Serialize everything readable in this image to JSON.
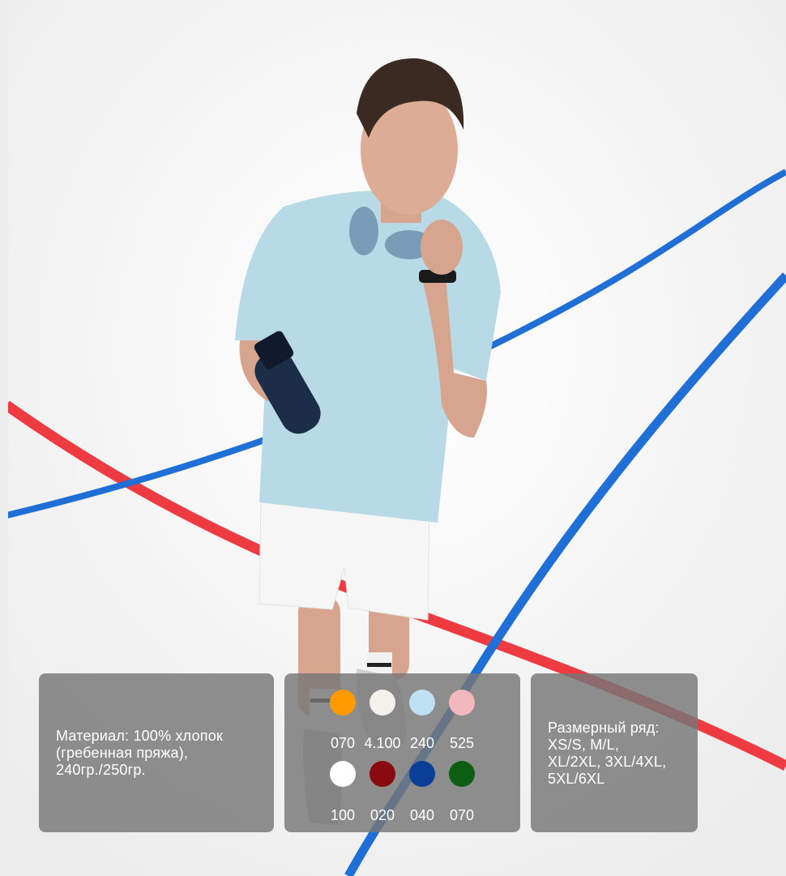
{
  "material": {
    "text": "Материал: 100% хлопок\n(гребенная пряжа),\n240гр./250гр."
  },
  "sizes": {
    "text": "Размерный ряд:\nXS/S, M/L,\nXL/2XL, 3XL/4XL,\n5XL/6XL"
  },
  "colors": [
    {
      "code": "070",
      "hex": "#ff9a00"
    },
    {
      "code": "4.100",
      "hex": "#f4f1ea"
    },
    {
      "code": "240",
      "hex": "#bfe0f3"
    },
    {
      "code": "525",
      "hex": "#f2b8bc"
    },
    {
      "code": "100",
      "hex": "#ffffff"
    },
    {
      "code": "020",
      "hex": "#8a0a12"
    },
    {
      "code": "040",
      "hex": "#0b3e97"
    },
    {
      "code": "070",
      "hex": "#0b5e12"
    }
  ],
  "accents": {
    "tape_red": "#ee3b42",
    "tape_blue": "#1f6fd6",
    "tshirt": "#b7dae6",
    "shorts": "#f6f6f6"
  }
}
